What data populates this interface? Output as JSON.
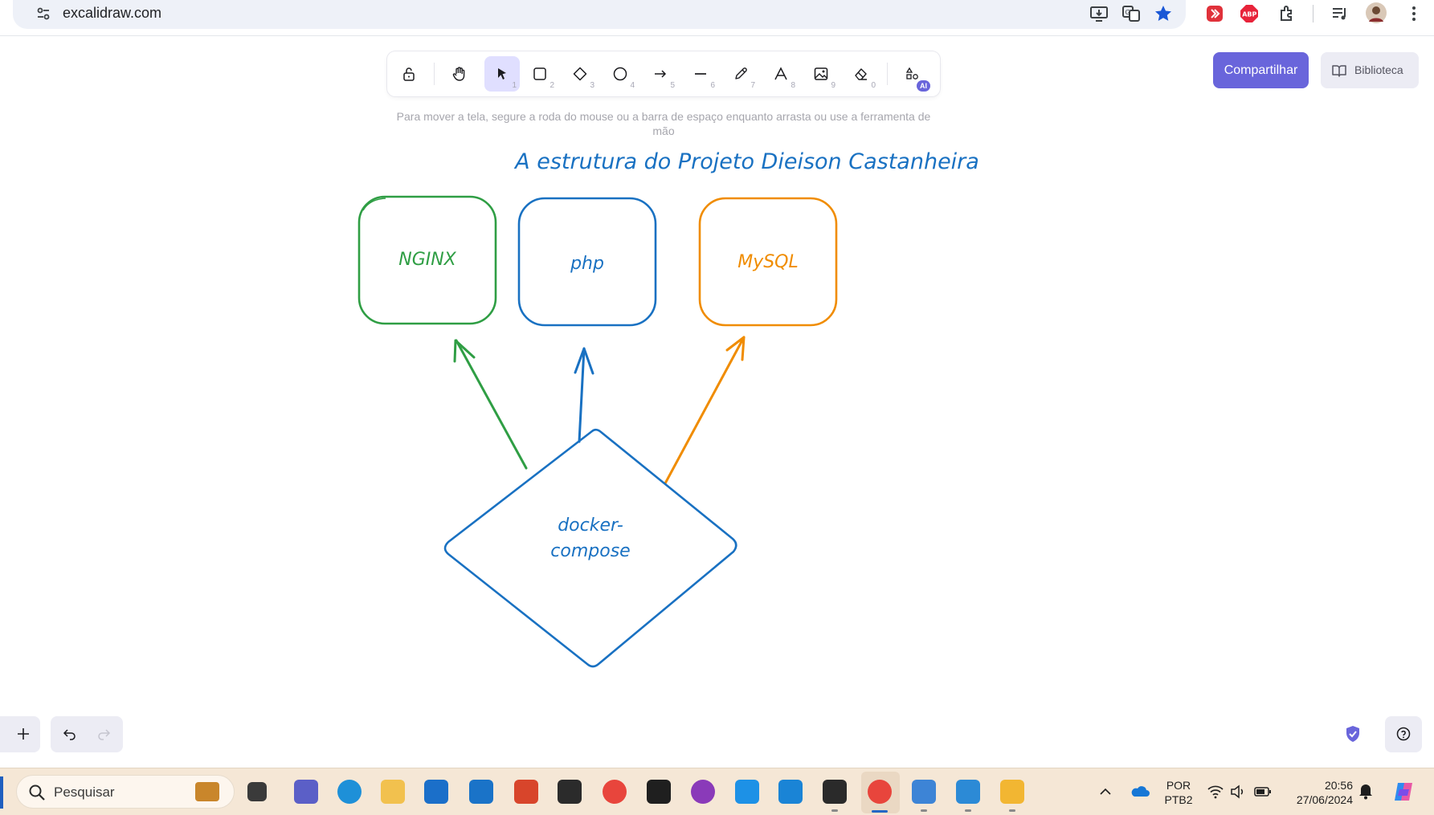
{
  "browser": {
    "url": "excalidraw.com"
  },
  "toolbar": {
    "tools": [
      {
        "name": "lock",
        "key": ""
      },
      {
        "name": "hand",
        "key": ""
      },
      {
        "name": "selection",
        "key": "1"
      },
      {
        "name": "rectangle",
        "key": "2"
      },
      {
        "name": "diamond",
        "key": "3"
      },
      {
        "name": "ellipse",
        "key": "4"
      },
      {
        "name": "arrow",
        "key": "5"
      },
      {
        "name": "line",
        "key": "6"
      },
      {
        "name": "draw",
        "key": "7"
      },
      {
        "name": "text",
        "key": "8"
      },
      {
        "name": "image",
        "key": "9"
      },
      {
        "name": "eraser",
        "key": "0"
      },
      {
        "name": "more-tools",
        "key": ""
      }
    ],
    "ai_badge": "AI",
    "active_tool": "selection"
  },
  "hint": "Para mover a tela, segure a roda do mouse ou a barra de espaço enquanto arrasta ou use a ferramenta de mão",
  "share_label": "Compartilhar",
  "library_label": "Biblioteca",
  "diagram": {
    "title": "A estrutura do Projeto Dieison Castanheira",
    "boxes": [
      {
        "label": "NGINX",
        "color": "#2f9e44"
      },
      {
        "label": "php",
        "color": "#1971c2"
      },
      {
        "label": "MySQL",
        "color": "#f08c00"
      }
    ],
    "center_label_line1": "docker-",
    "center_label_line2": "compose",
    "center_color": "#1971c2"
  },
  "colors": {
    "accent": "#6965db",
    "accent_light": "#e0dfff",
    "taskbar": "#f5e7d6"
  },
  "taskbar": {
    "search_placeholder": "Pesquisar",
    "language_line1": "POR",
    "language_line2": "PTB2",
    "time": "20:56",
    "date": "27/06/2024"
  }
}
